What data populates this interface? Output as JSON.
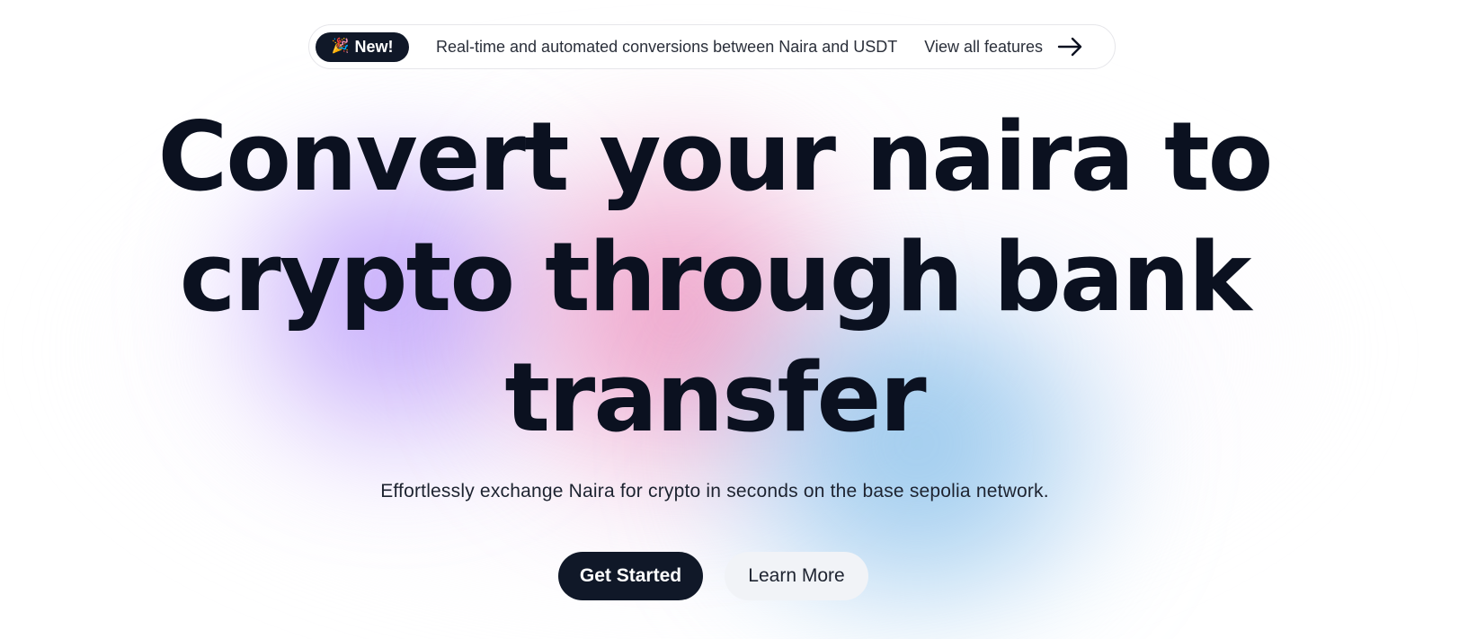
{
  "announcement": {
    "badge_label": "New!",
    "badge_icon": "party-popper-icon",
    "text": "Real-time and automated conversions between Naira and USDT",
    "link_label": "View all features",
    "link_icon": "arrow-right-icon"
  },
  "hero": {
    "headline": "Convert your naira to crypto through bank transfer",
    "subtitle": "Effortlessly exchange Naira for crypto in seconds on the base sepolia network."
  },
  "actions": {
    "primary_label": "Get Started",
    "secondary_label": "Learn More"
  },
  "colors": {
    "primary_dark": "#101828",
    "headline_text": "#0b1120",
    "secondary_button_bg": "#f1f3f7",
    "accent_purple": "#af8cfa",
    "accent_pink": "#eb82b4",
    "accent_blue": "#78b9e6"
  }
}
